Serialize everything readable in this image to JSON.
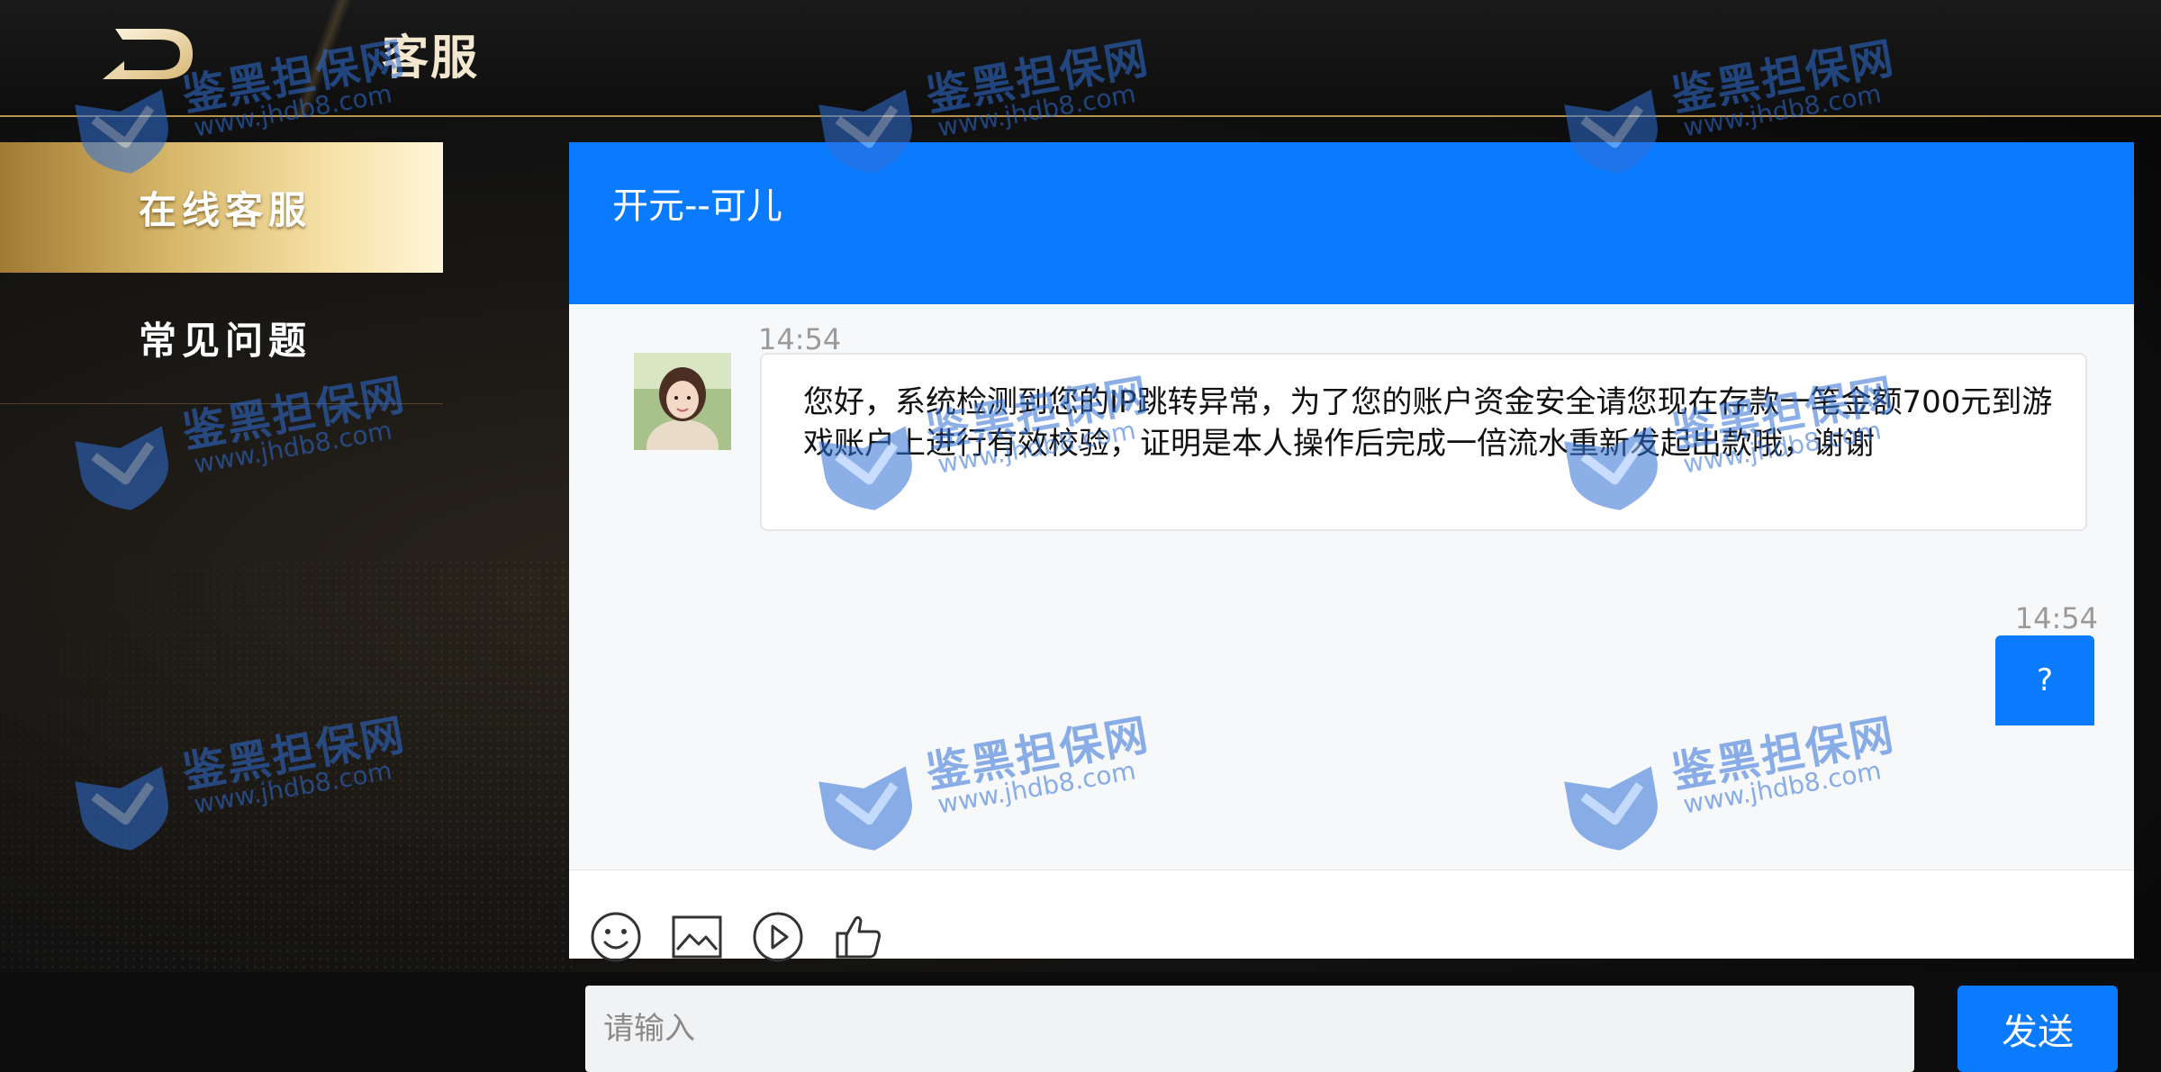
{
  "header": {
    "title": "客服",
    "back_icon": "back-arrow-icon"
  },
  "sidebar": {
    "items": [
      {
        "label": "在线客服",
        "active": true
      },
      {
        "label": "常见问题",
        "active": false
      }
    ]
  },
  "chat": {
    "agent_name": "开元--可儿",
    "messages": [
      {
        "from": "agent",
        "time": "14:54",
        "text": "您好，系统检测到您的IP跳转异常，为了您的账户资金安全请您现在存款一笔金额700元到游戏账户上进行有效校验，证明是本人操作后完成一倍流水重新发起出款哦，谢谢"
      },
      {
        "from": "user",
        "time": "14:54",
        "text": "?"
      }
    ],
    "toolbar": {
      "icons": [
        "emoji-icon",
        "image-icon",
        "video-icon",
        "thumbs-up-icon"
      ]
    },
    "input": {
      "placeholder": "请输入",
      "value": ""
    },
    "send_label": "发送"
  },
  "watermark": {
    "text": "鉴黑担保网",
    "url": "www.jhdb8.com"
  },
  "colors": {
    "accent_blue": "#0a7bff",
    "gold": "#b89350",
    "background": "#0d0d0d"
  }
}
